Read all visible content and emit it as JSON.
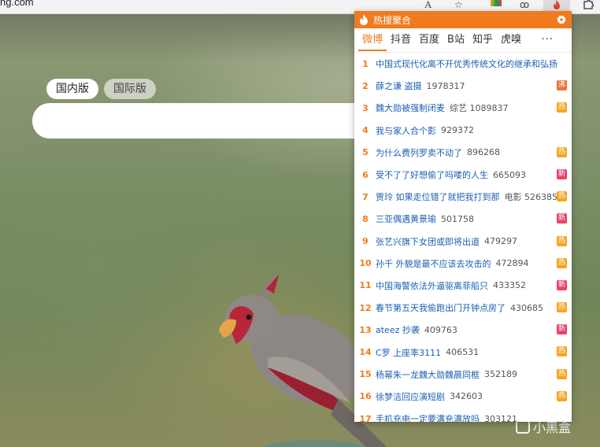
{
  "browser": {
    "url_fragment": "ng.com",
    "reader_icon": "A",
    "star_icon": "☆",
    "ext_icon": "ꝏ",
    "fire_ext_icon": "🔥"
  },
  "home": {
    "tab_domestic": "国内版",
    "tab_international": "国际版"
  },
  "panel": {
    "title": "热搜聚合",
    "sources": [
      "微博",
      "抖音",
      "百度",
      "B站",
      "知乎",
      "虎嗅"
    ],
    "more": "···",
    "items": [
      {
        "rank": "1",
        "title": "中国式现代化离不开优秀传统文化的继承和弘扬",
        "heat": "",
        "badge": ""
      },
      {
        "rank": "2",
        "title": "薛之谦 盗摄",
        "heat": "1978317",
        "badge": "沸"
      },
      {
        "rank": "3",
        "title": "魏大勋被强制闭麦",
        "heat": "综艺 1089837",
        "badge": "热"
      },
      {
        "rank": "4",
        "title": "我与家人合个影",
        "heat": "929372",
        "badge": ""
      },
      {
        "rank": "5",
        "title": "为什么费列罗卖不动了",
        "heat": "896268",
        "badge": "热"
      },
      {
        "rank": "6",
        "title": "受不了了好想偷了吗喽的人生",
        "heat": "665093",
        "badge": "新"
      },
      {
        "rank": "7",
        "title": "贾玲 如果走位错了就把我打到那",
        "heat": "电影 526385",
        "badge": "热"
      },
      {
        "rank": "8",
        "title": "三亚偶遇黄景瑜",
        "heat": "501758",
        "badge": "新"
      },
      {
        "rank": "9",
        "title": "张艺兴旗下女团或即将出道",
        "heat": "479297",
        "badge": "热"
      },
      {
        "rank": "10",
        "title": "孙千 外貌是最不应该去攻击的",
        "heat": "472894",
        "badge": "热"
      },
      {
        "rank": "11",
        "title": "中国海警依法外逼驱离菲船只",
        "heat": "433352",
        "badge": "新"
      },
      {
        "rank": "12",
        "title": "春节第五天我偷跑出门开钟点房了",
        "heat": "430685",
        "badge": "热"
      },
      {
        "rank": "13",
        "title": "ateez 抄袭",
        "heat": "409763",
        "badge": "新"
      },
      {
        "rank": "14",
        "title": "C罗 上座率3111",
        "heat": "406531",
        "badge": "热"
      },
      {
        "rank": "15",
        "title": "杨幂朱一龙魏大勋魏晨同框",
        "heat": "352189",
        "badge": "热"
      },
      {
        "rank": "16",
        "title": "徐梦洁回应演短剧",
        "heat": "342603",
        "badge": "热"
      },
      {
        "rank": "17",
        "title": "手机充电一定要满充满放吗",
        "heat": "303121",
        "badge": ""
      }
    ]
  },
  "watermark": "小黑盒",
  "colors": {
    "accent": "#f07b1e",
    "link": "#1a5fb4",
    "badge_hot": "#f5a623",
    "badge_new": "#e9436a",
    "badge_boil": "#e9743a"
  }
}
